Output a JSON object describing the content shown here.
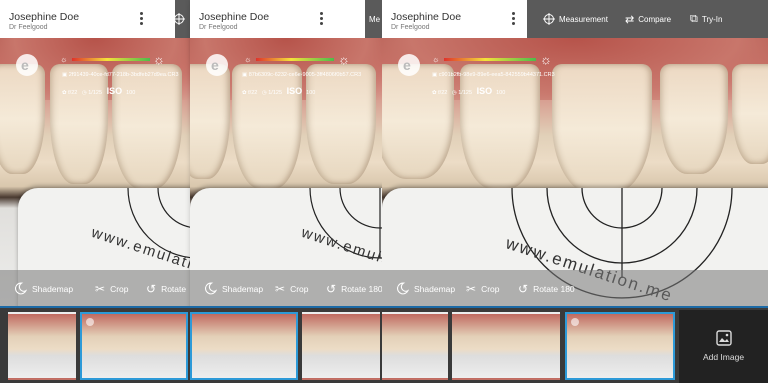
{
  "user": {
    "name": "Josephine Doe",
    "subtitle": "Dr Feelgood"
  },
  "toolbar": {
    "measurement": "Measurement",
    "compare": "Compare",
    "tryin": "Try-In",
    "measurement_partial": "Me"
  },
  "photos": [
    {
      "id": "2f91439-40ce-fd77-218b-3bdfeb27d9ea.CR3",
      "aperture": "f/22",
      "shutter": "1/125",
      "iso_label": "ISO",
      "iso": "100"
    },
    {
      "id": "87b6309c-6232-ce6e-9005-3ff4806f0b57.CR3",
      "aperture": "f/22",
      "shutter": "1/125",
      "iso_label": "ISO",
      "iso": "100"
    },
    {
      "id": "c901b2fb-98e9-89e6-eea5-842559b44371.CR3",
      "aperture": "f/22",
      "shutter": "1/125",
      "iso_label": "ISO",
      "iso": "100"
    }
  ],
  "bottom_tools": {
    "shademap": "Shademap",
    "crop": "Crop",
    "rotate": "Rotate",
    "rotate180": "Rotate 180"
  },
  "watermark": "www.emulation.me",
  "add_image": "Add Image",
  "colors": {
    "accent": "#2d9ad8",
    "toolbar": "#5a5a5a"
  }
}
